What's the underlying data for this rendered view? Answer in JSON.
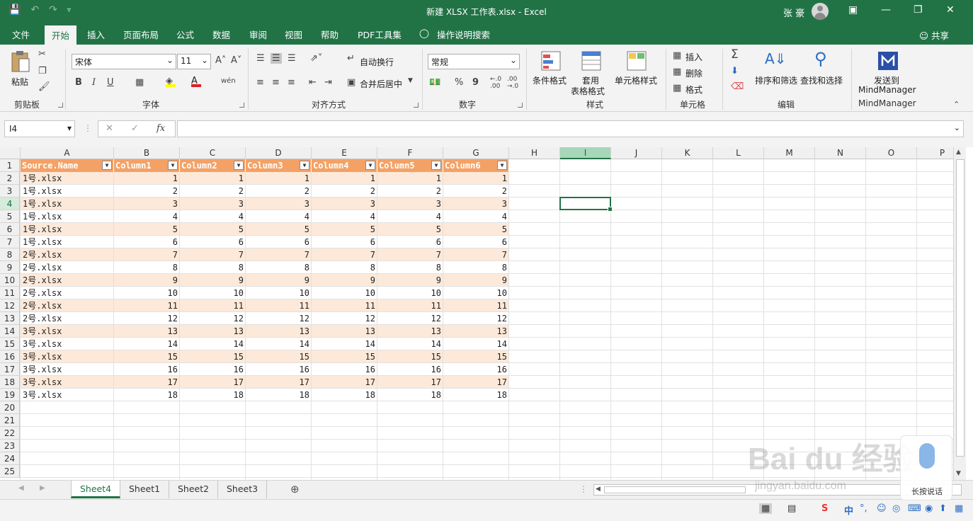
{
  "titlebar": {
    "doc_title": "新建 XLSX 工作表.xlsx  -  Excel",
    "user": "张 豪",
    "bg": "#217346"
  },
  "tabs": [
    "文件",
    "开始",
    "插入",
    "页面布局",
    "公式",
    "数据",
    "审阅",
    "视图",
    "帮助",
    "PDF工具集",
    "操作说明搜索"
  ],
  "share": "共享",
  "ribbon": {
    "clipboard": {
      "paste": "粘贴",
      "label": "剪贴板"
    },
    "font": {
      "name": "宋体",
      "size": "11",
      "label": "字体",
      "bold": "B",
      "italic": "I",
      "underline": "U",
      "phonetic": "wén"
    },
    "alignment": {
      "wrap": "自动换行",
      "merge": "合并后居中",
      "label": "对齐方式"
    },
    "number": {
      "format": "常规",
      "label": "数字",
      "percent": "%",
      "comma": "9"
    },
    "styles": {
      "cond": "条件格式",
      "table1": "套用",
      "table2": "表格格式",
      "cell": "单元格样式",
      "label": "样式"
    },
    "cells": {
      "insert": "插入",
      "delete": "删除",
      "format": "格式",
      "label": "单元格"
    },
    "editing": {
      "sort": "排序和筛选",
      "find": "查找和选择",
      "label": "编辑"
    },
    "mindmanager": {
      "send1": "发送到",
      "send2": "MindManager",
      "label": "MindManager"
    }
  },
  "formula": {
    "namebox": "I4",
    "fx": "fx",
    "value": ""
  },
  "columns": [
    "A",
    "B",
    "C",
    "D",
    "E",
    "F",
    "G",
    "H",
    "I",
    "J",
    "K",
    "L",
    "M",
    "N",
    "O",
    "P"
  ],
  "table": {
    "headers": [
      "Source.Name",
      "Column1",
      "Column2",
      "Column3",
      "Column4",
      "Column5",
      "Column6"
    ],
    "header_color": "#f4a166",
    "band_color": "#fde9d9",
    "rows": [
      [
        "1号.xlsx",
        1,
        1,
        1,
        1,
        1,
        1
      ],
      [
        "1号.xlsx",
        2,
        2,
        2,
        2,
        2,
        2
      ],
      [
        "1号.xlsx",
        3,
        3,
        3,
        3,
        3,
        3
      ],
      [
        "1号.xlsx",
        4,
        4,
        4,
        4,
        4,
        4
      ],
      [
        "1号.xlsx",
        5,
        5,
        5,
        5,
        5,
        5
      ],
      [
        "1号.xlsx",
        6,
        6,
        6,
        6,
        6,
        6
      ],
      [
        "2号.xlsx",
        7,
        7,
        7,
        7,
        7,
        7
      ],
      [
        "2号.xlsx",
        8,
        8,
        8,
        8,
        8,
        8
      ],
      [
        "2号.xlsx",
        9,
        9,
        9,
        9,
        9,
        9
      ],
      [
        "2号.xlsx",
        10,
        10,
        10,
        10,
        10,
        10
      ],
      [
        "2号.xlsx",
        11,
        11,
        11,
        11,
        11,
        11
      ],
      [
        "2号.xlsx",
        12,
        12,
        12,
        12,
        12,
        12
      ],
      [
        "3号.xlsx",
        13,
        13,
        13,
        13,
        13,
        13
      ],
      [
        "3号.xlsx",
        14,
        14,
        14,
        14,
        14,
        14
      ],
      [
        "3号.xlsx",
        15,
        15,
        15,
        15,
        15,
        15
      ],
      [
        "3号.xlsx",
        16,
        16,
        16,
        16,
        16,
        16
      ],
      [
        "3号.xlsx",
        17,
        17,
        17,
        17,
        17,
        17
      ],
      [
        "3号.xlsx",
        18,
        18,
        18,
        18,
        18,
        18
      ]
    ]
  },
  "row_numbers": [
    "1",
    "2",
    "3",
    "4",
    "5",
    "6",
    "7",
    "8",
    "9",
    "10",
    "11",
    "12",
    "13",
    "14",
    "15",
    "16",
    "17",
    "18",
    "19",
    "20",
    "21",
    "22",
    "23",
    "24",
    "25"
  ],
  "selected": {
    "col": "I",
    "row": "4"
  },
  "sheets": [
    "Sheet4",
    "Sheet1",
    "Sheet2",
    "Sheet3"
  ],
  "active_sheet": "Sheet4",
  "status": {
    "ime": "中"
  },
  "watermark": {
    "text": "Bai du 经验",
    "url": "jingyan.baidu.com",
    "voice": "长按说话"
  }
}
